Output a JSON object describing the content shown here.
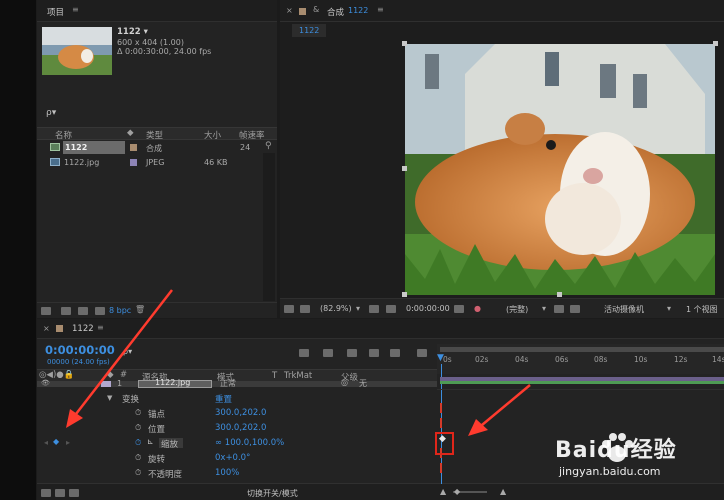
{
  "project": {
    "panel_title": "项目",
    "comp_name": "1122 ▾",
    "comp_size": "600 x 404 (1.00)",
    "comp_duration": "Δ 0:00:30:00, 24.00 fps",
    "search_placeholder": "ρ▾",
    "columns": [
      "名称",
      "类型",
      "大小",
      "帧速率"
    ],
    "rows": [
      {
        "name": "1122",
        "type": "合成",
        "size": "",
        "fps": "24"
      },
      {
        "name": "1122.jpg",
        "type": "JPEG",
        "size": "46 KB",
        "fps": ""
      }
    ],
    "bpc": "8 bpc"
  },
  "viewer": {
    "tab_label": "合成",
    "tab_name": "1122",
    "sub_tab": "1122",
    "zoom": "(82.9%)",
    "timecode": "0:00:00:00",
    "quality": "(完整)",
    "camera": "活动摄像机",
    "views": "1 个视图"
  },
  "timeline": {
    "tab_name": "1122",
    "timecode": "0:00:00:00",
    "fps_note": "00000 (24.00 fps)",
    "search_placeholder": "ρ▾",
    "col_source": "源名称",
    "col_mode": "模式",
    "col_t": "T",
    "col_trkmat": "TrkMat",
    "col_parent": "父级",
    "layer_num": "1",
    "layer_name": "1122.jpg",
    "layer_mode": "正常",
    "layer_parent": "无",
    "transform_label": "变换",
    "reset_label": "重置",
    "props": [
      {
        "name": "锚点",
        "value": "300.0,202.0"
      },
      {
        "name": "位置",
        "value": "300.0,202.0"
      },
      {
        "name": "缩放",
        "value": "∞ 100.0,100.0%"
      },
      {
        "name": "旋转",
        "value": "0x+0.0°"
      },
      {
        "name": "不透明度",
        "value": "100%"
      }
    ],
    "footer_toggle": "切换开关/模式",
    "ruler_ticks": [
      "0s",
      "02s",
      "04s",
      "06s",
      "08s",
      "10s",
      "12s",
      "14s"
    ]
  },
  "watermark": {
    "brand": "Baidu经验",
    "url": "jingyan.baidu.com"
  }
}
